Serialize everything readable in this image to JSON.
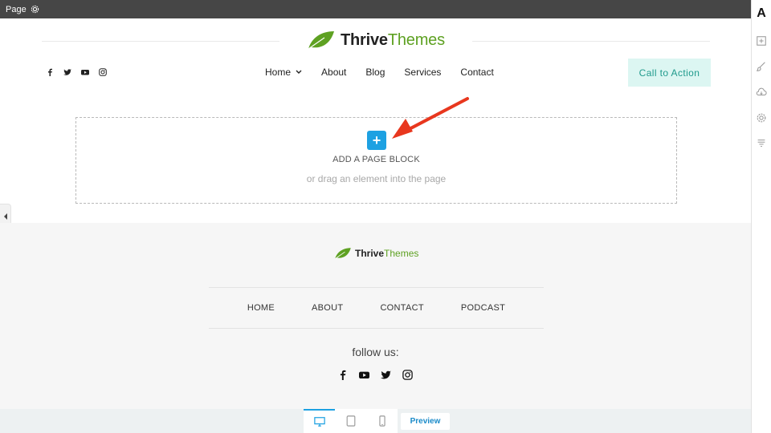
{
  "topbar": {
    "label": "Page",
    "icon": "gear-icon"
  },
  "header": {
    "brand_main": "Thrive",
    "brand_accent": "Themes",
    "nav": [
      "Home",
      "About",
      "Blog",
      "Services",
      "Contact"
    ],
    "cta": "Call to Action",
    "social": [
      "facebook-icon",
      "twitter-icon",
      "youtube-icon",
      "instagram-icon"
    ]
  },
  "dropzone": {
    "plus": "+",
    "title": "ADD A PAGE BLOCK",
    "subtitle": "or drag an element into the page"
  },
  "footer": {
    "brand_main": "Thrive",
    "brand_accent": "Themes",
    "nav": [
      "HOME",
      "ABOUT",
      "CONTACT",
      "PODCAST"
    ],
    "follow": "follow us:",
    "social": [
      "facebook-icon",
      "youtube-icon",
      "twitter-icon",
      "instagram-icon"
    ]
  },
  "bottombar": {
    "devices": [
      "desktop-icon",
      "tablet-icon",
      "mobile-icon"
    ],
    "preview": "Preview"
  },
  "sidebar": {
    "logo": "A",
    "icons": [
      "add-element-icon",
      "brush-icon",
      "cloud-icon",
      "gear-icon",
      "custom-icon"
    ]
  },
  "colors": {
    "accent": "#1da1e2",
    "brand_green": "#5ea122",
    "cta_bg": "#dcf6f2",
    "cta_text": "#1f9a8c",
    "arrow": "#e8371e"
  }
}
